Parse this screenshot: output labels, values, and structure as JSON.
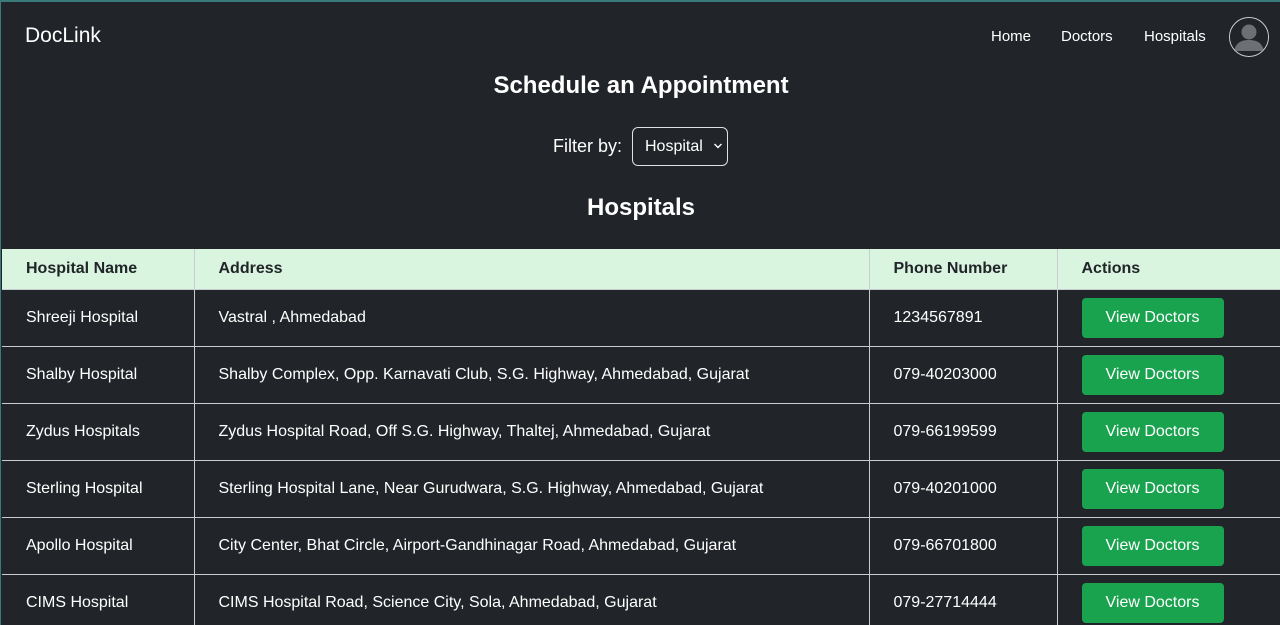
{
  "navbar": {
    "brand": "DocLink",
    "links": [
      {
        "label": "Home"
      },
      {
        "label": "Doctors"
      },
      {
        "label": "Hospitals"
      }
    ]
  },
  "main": {
    "title": "Schedule an Appointment",
    "filter": {
      "label": "Filter by:",
      "selected": "Hospital"
    },
    "section_title": "Hospitals",
    "table": {
      "headers": [
        "Hospital Name",
        "Address",
        "Phone Number",
        "Actions"
      ],
      "rows": [
        {
          "name": "Shreeji Hospital",
          "address": "Vastral , Ahmedabad",
          "phone": "1234567891",
          "action": "View Doctors"
        },
        {
          "name": "Shalby Hospital",
          "address": "Shalby Complex, Opp. Karnavati Club, S.G. Highway, Ahmedabad, Gujarat",
          "phone": "079-40203000",
          "action": "View Doctors"
        },
        {
          "name": "Zydus Hospitals",
          "address": "Zydus Hospital Road, Off S.G. Highway, Thaltej, Ahmedabad, Gujarat",
          "phone": "079-66199599",
          "action": "View Doctors"
        },
        {
          "name": "Sterling Hospital",
          "address": "Sterling Hospital Lane, Near Gurudwara, S.G. Highway, Ahmedabad, Gujarat",
          "phone": "079-40201000",
          "action": "View Doctors"
        },
        {
          "name": "Apollo Hospital",
          "address": "City Center, Bhat Circle, Airport-Gandhinagar Road, Ahmedabad, Gujarat",
          "phone": "079-66701800",
          "action": "View Doctors"
        },
        {
          "name": "CIMS Hospital",
          "address": "CIMS Hospital Road, Science City, Sola, Ahmedabad, Gujarat",
          "phone": "079-27714444",
          "action": "View Doctors"
        }
      ]
    }
  },
  "colors": {
    "background": "#212529",
    "header_row": "#d9f5e0",
    "button": "#1aa34e"
  },
  "icons": {
    "avatar": "user-avatar-icon",
    "select_arrow": "chevron-down-icon"
  }
}
